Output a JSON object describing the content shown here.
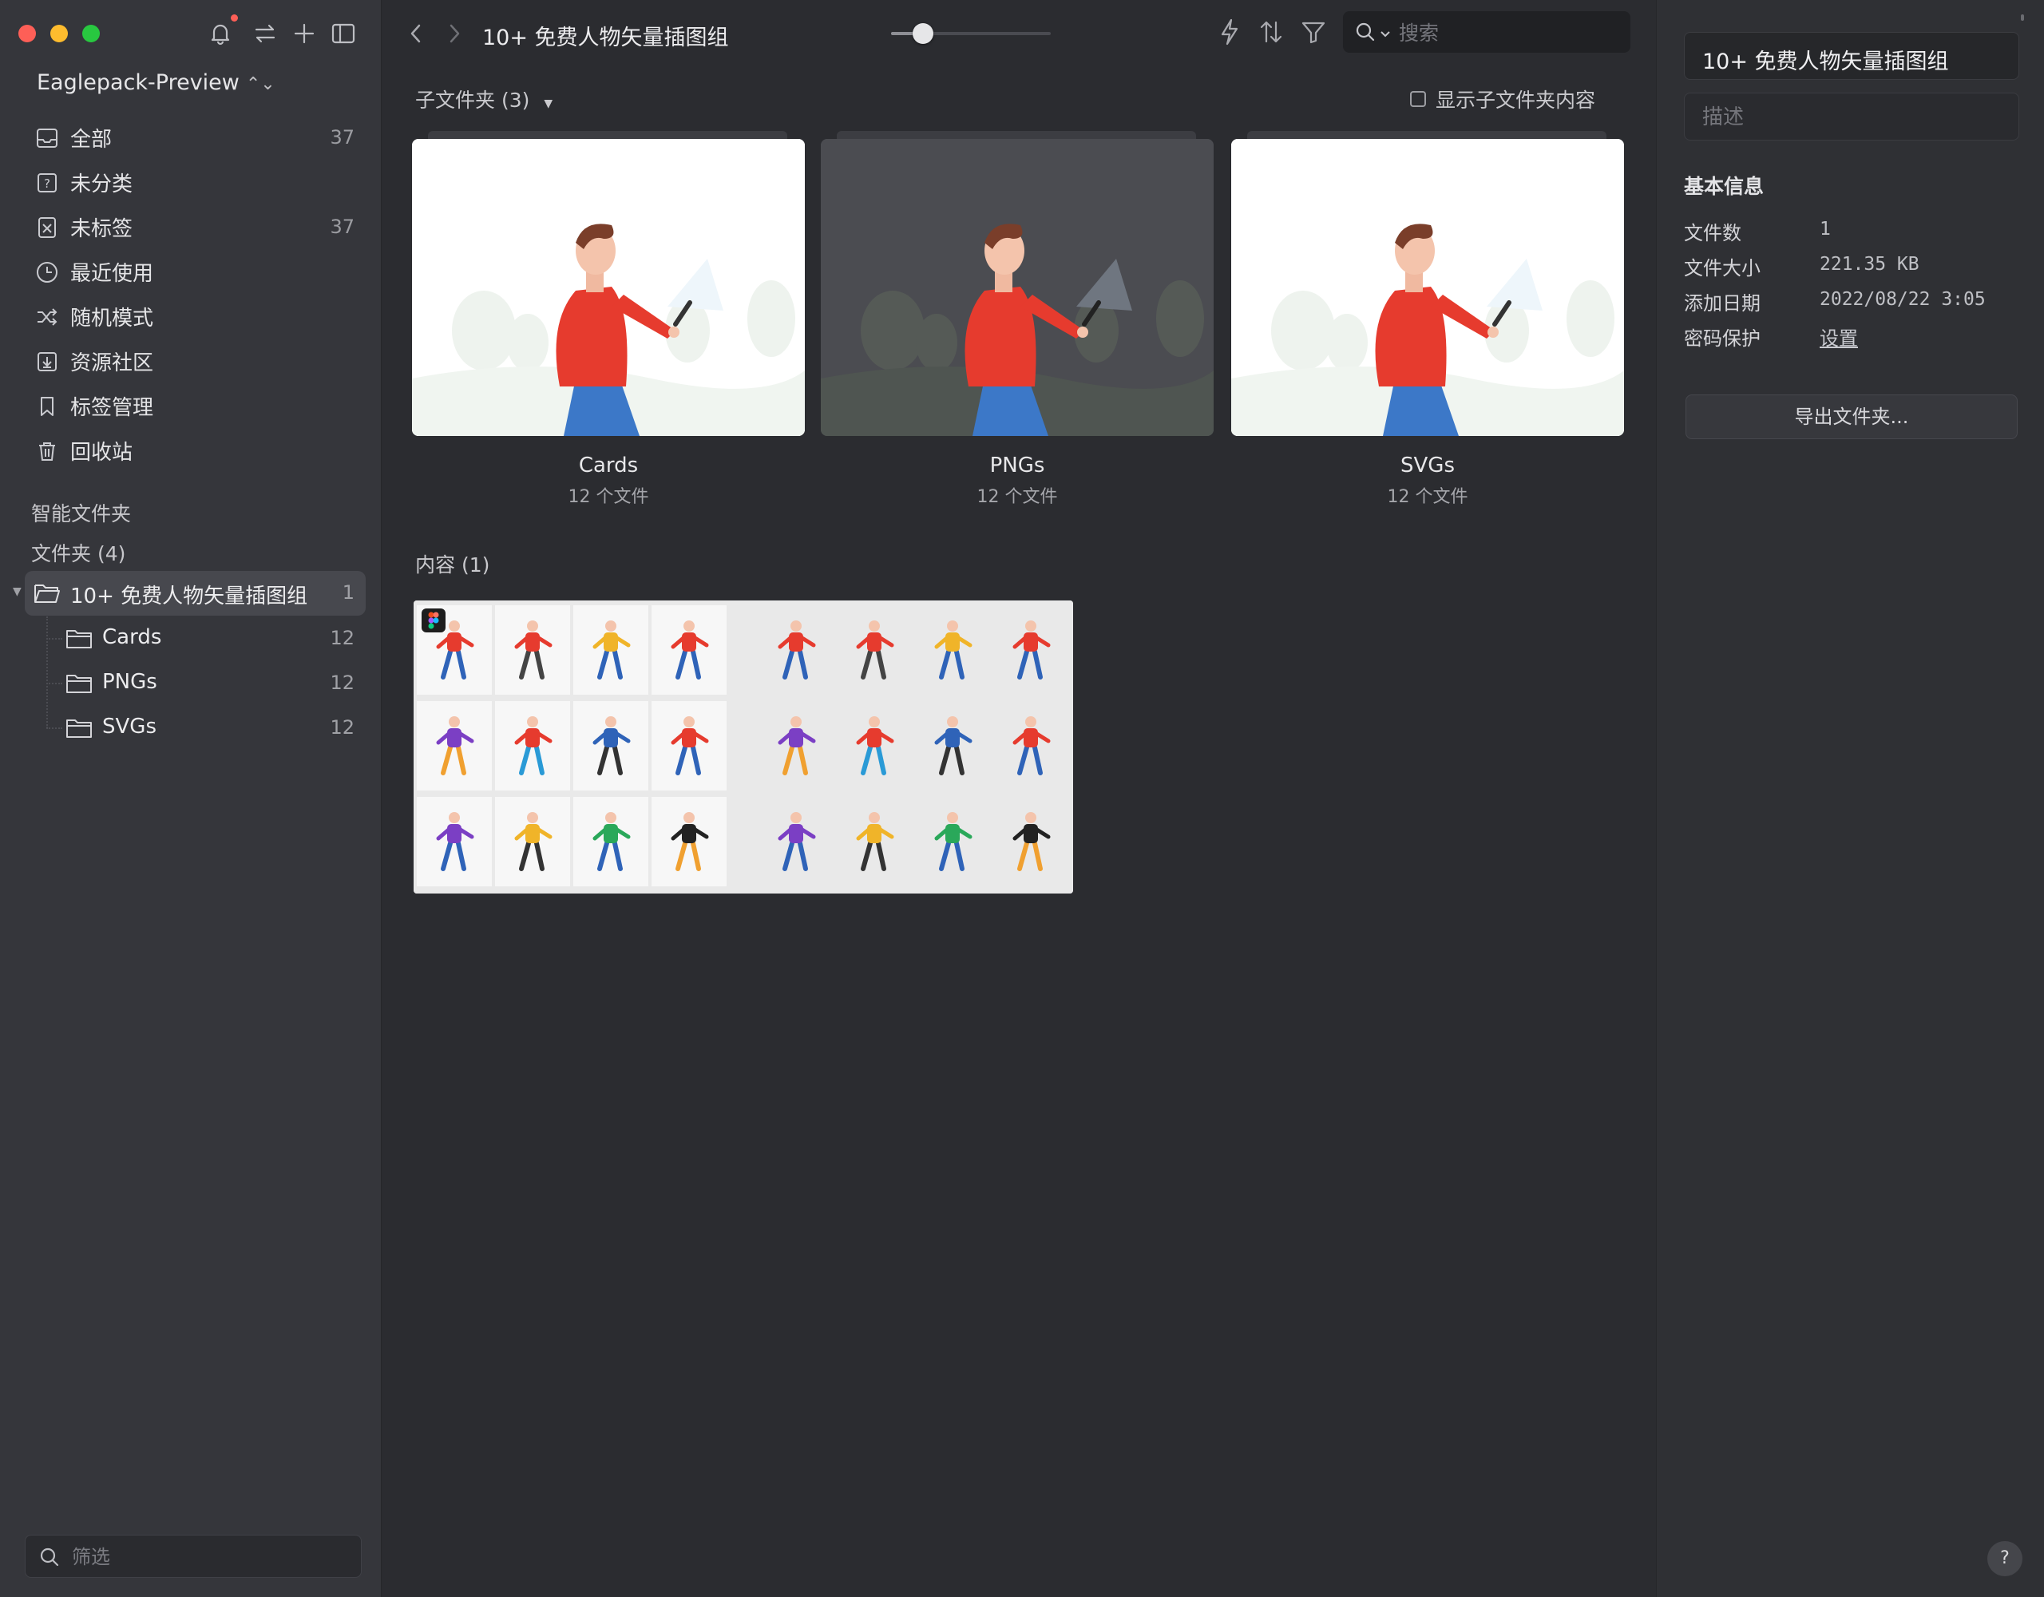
{
  "sidebar": {
    "library_name": "Eaglepack-Preview",
    "nav_items": [
      {
        "label": "全部",
        "count": "37",
        "icon": "inbox-icon"
      },
      {
        "label": "未分类",
        "count": "",
        "icon": "question-square-icon"
      },
      {
        "label": "未标签",
        "count": "37",
        "icon": "tag-off-icon"
      },
      {
        "label": "最近使用",
        "count": "",
        "icon": "clock-icon"
      },
      {
        "label": "随机模式",
        "count": "",
        "icon": "shuffle-icon"
      },
      {
        "label": "资源社区",
        "count": "",
        "icon": "download-box-icon"
      },
      {
        "label": "标签管理",
        "count": "",
        "icon": "bookmark-icon"
      },
      {
        "label": "回收站",
        "count": "",
        "icon": "trash-icon"
      }
    ],
    "smart_folders_label": "智能文件夹",
    "folders_label": "文件夹 (4)",
    "tree": {
      "root": {
        "label": "10+ 免费人物矢量插图组",
        "count": "1"
      },
      "children": [
        {
          "label": "Cards",
          "count": "12"
        },
        {
          "label": "PNGs",
          "count": "12"
        },
        {
          "label": "SVGs",
          "count": "12"
        }
      ]
    },
    "filter_placeholder": "筛选"
  },
  "toolbar": {
    "title": "10+ 免费人物矢量插图组",
    "zoom_fraction": 0.2,
    "search_placeholder": "搜索"
  },
  "main": {
    "subfolders_header": "子文件夹 (3)",
    "show_subfolder_content": "显示子文件夹内容",
    "subfolders": [
      {
        "name": "Cards",
        "count": "12 个文件",
        "theme": "light"
      },
      {
        "name": "PNGs",
        "count": "12 个文件",
        "theme": "dark"
      },
      {
        "name": "SVGs",
        "count": "12 个文件",
        "theme": "light"
      }
    ],
    "content_header": "内容 (1)"
  },
  "inspector": {
    "name": "10+ 免费人物矢量插图组",
    "description_placeholder": "描述",
    "section_title": "基本信息",
    "rows": [
      {
        "label": "文件数",
        "value": "1"
      },
      {
        "label": "文件大小",
        "value": "221.35 KB"
      },
      {
        "label": "添加日期",
        "value": "2022/08/22 3:05"
      },
      {
        "label": "密码保护",
        "value": "设置"
      }
    ],
    "export_label": "导出文件夹...",
    "help_label": "?"
  },
  "colors": {
    "sidebar_bg": "#35363b",
    "main_bg": "#2b2c30",
    "selection": "#47484e",
    "close": "#fe5f57",
    "minimize": "#febc2e",
    "zoom": "#28c840"
  }
}
